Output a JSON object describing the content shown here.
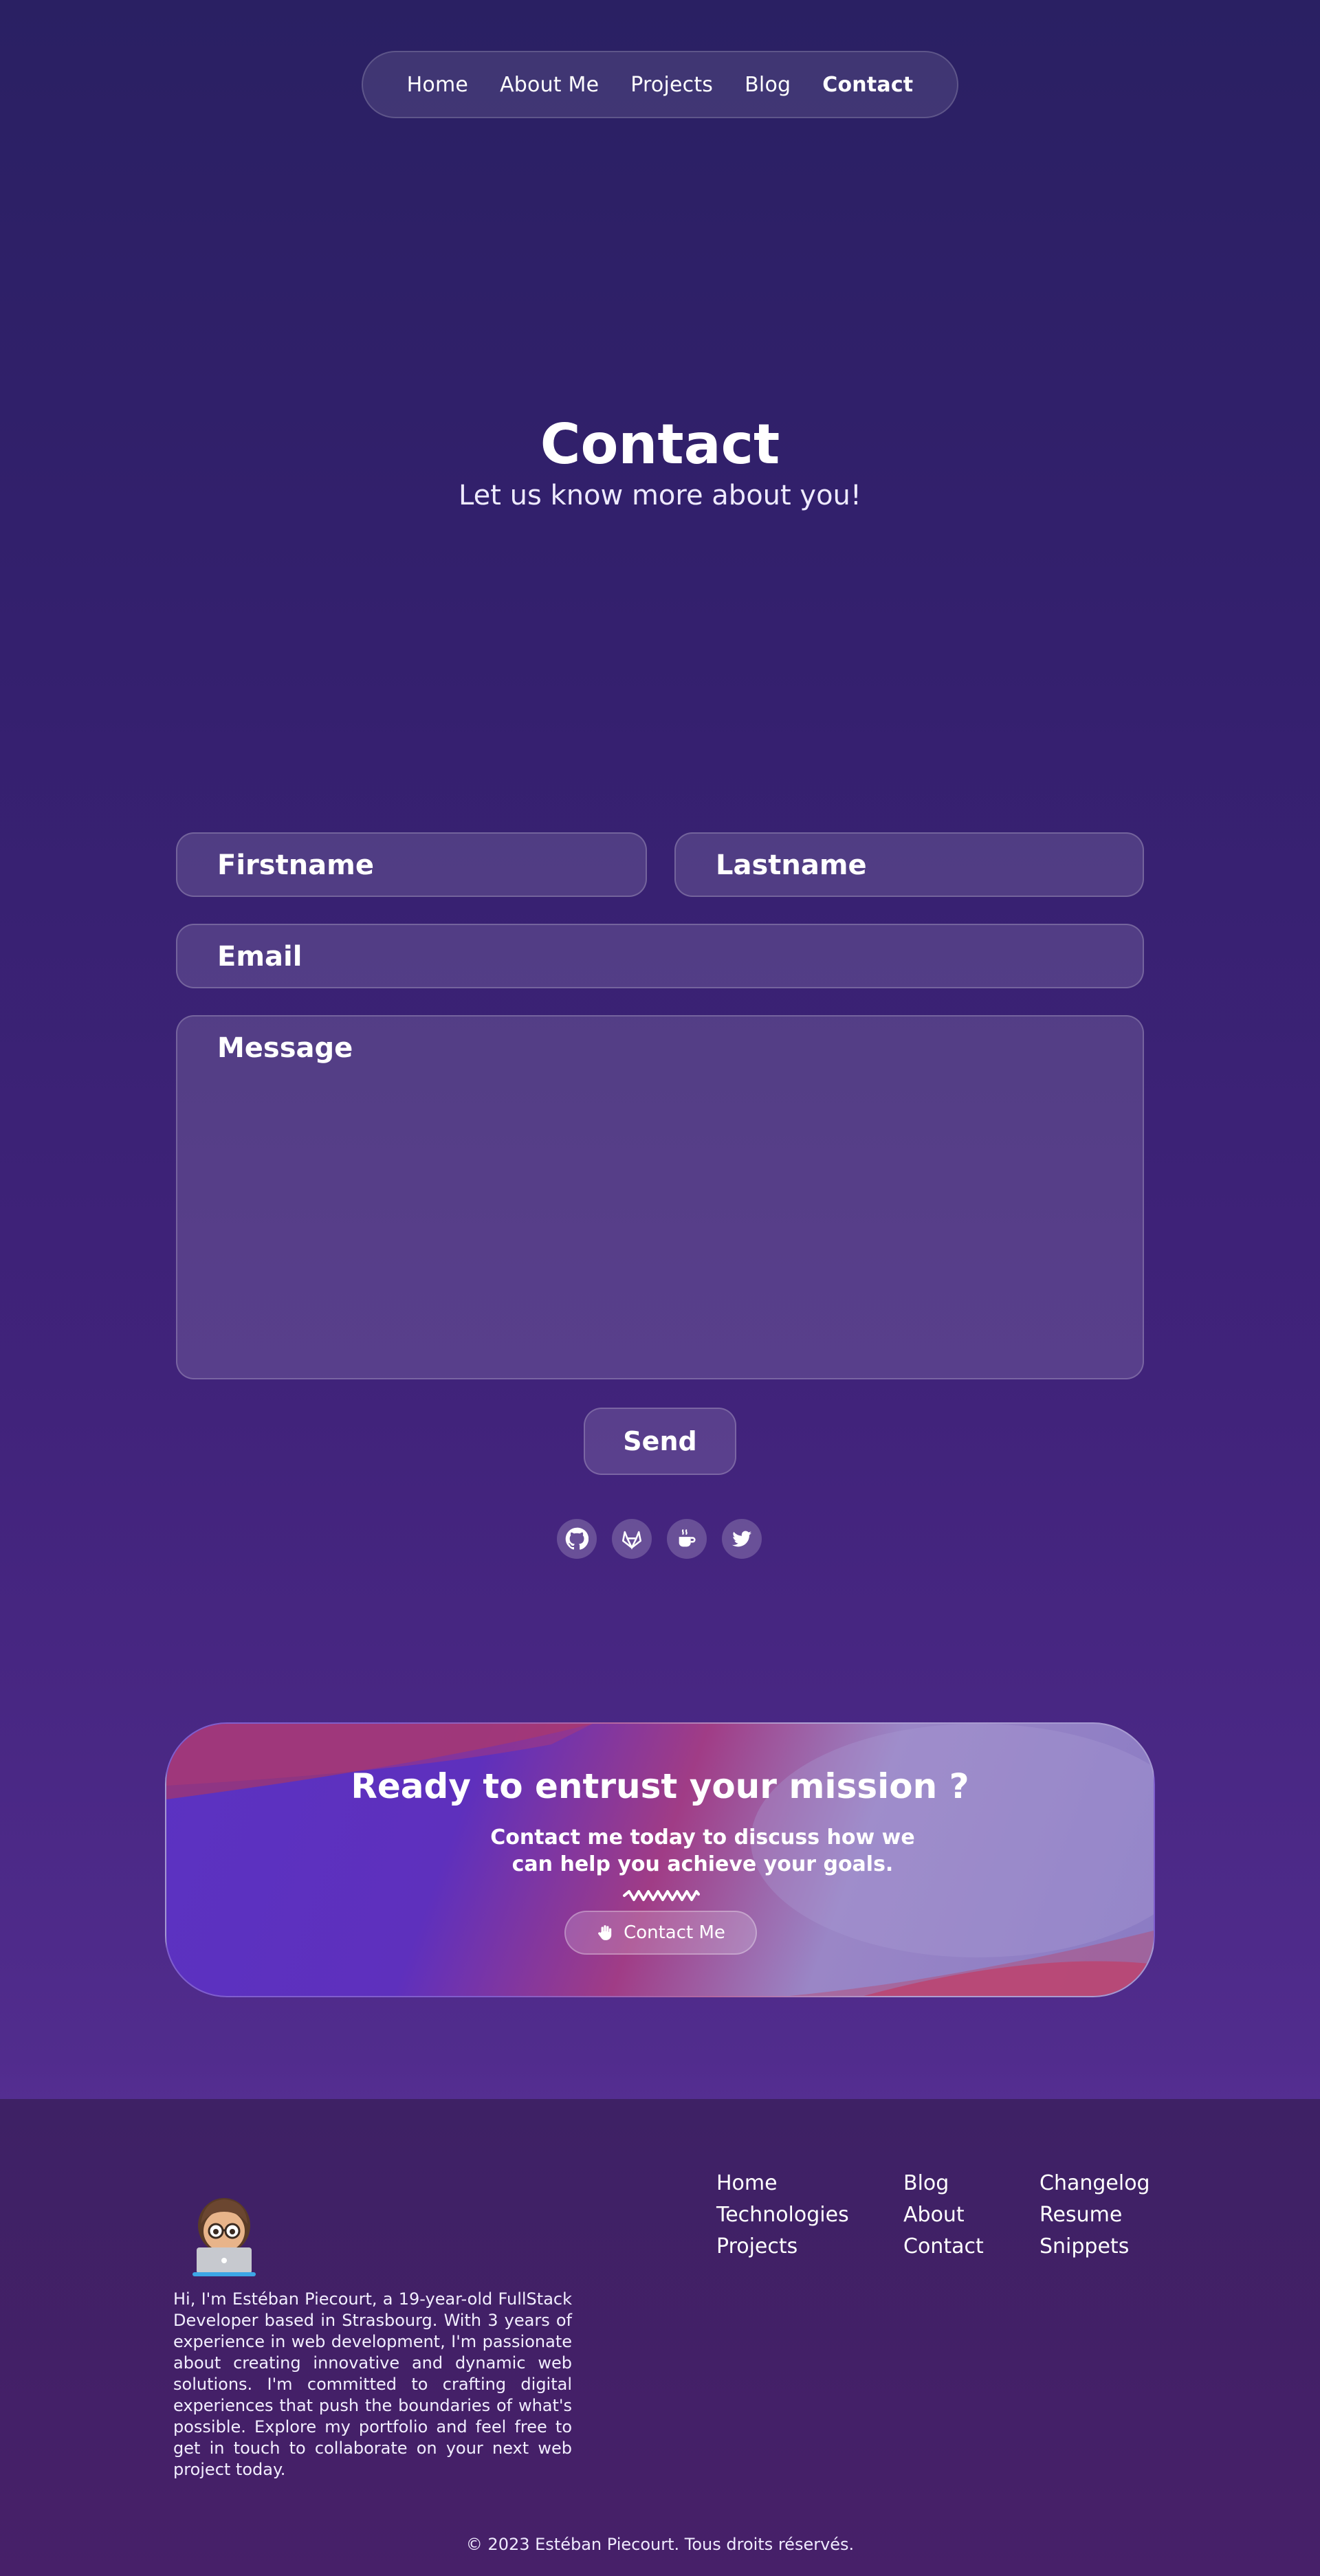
{
  "nav": {
    "items": [
      {
        "label": "Home"
      },
      {
        "label": "About Me"
      },
      {
        "label": "Projects"
      },
      {
        "label": "Blog"
      },
      {
        "label": "Contact"
      }
    ]
  },
  "hero": {
    "title": "Contact",
    "subtitle": "Let us know more about you!"
  },
  "form": {
    "firstname_placeholder": "Firstname",
    "lastname_placeholder": "Lastname",
    "email_placeholder": "Email",
    "message_placeholder": "Message",
    "send_label": "Send"
  },
  "socials": [
    {
      "icon": "github-icon"
    },
    {
      "icon": "gitlab-icon"
    },
    {
      "icon": "coffee-icon"
    },
    {
      "icon": "twitter-icon"
    }
  ],
  "cta": {
    "title": "Ready to entrust your mission ?",
    "text": "Contact me today to discuss how we can help you achieve your goals.",
    "button_label": "Contact Me"
  },
  "footer": {
    "bio": "Hi, I'm Estéban Piecourt, a 19-year-old FullStack Developer based in Strasbourg. With 3 years of experience in web development, I'm passionate about creating innovative and dynamic web solutions. I'm committed to crafting digital experiences that push the boundaries of what's possible. Explore my portfolio and feel free to get in touch to collaborate on your next web project today.",
    "col1": [
      "Home",
      "Technologies",
      "Projects"
    ],
    "col2": [
      "Blog",
      "About",
      "Contact"
    ],
    "col3": [
      "Changelog",
      "Resume",
      "Snippets"
    ],
    "copyright": "© 2023 Estéban Piecourt. Tous droits réservés."
  },
  "colors": {
    "bg_top": "#2a2063",
    "bg_bottom": "#552e92",
    "footer_bg": "#3e2165",
    "text": "#ffffff"
  }
}
